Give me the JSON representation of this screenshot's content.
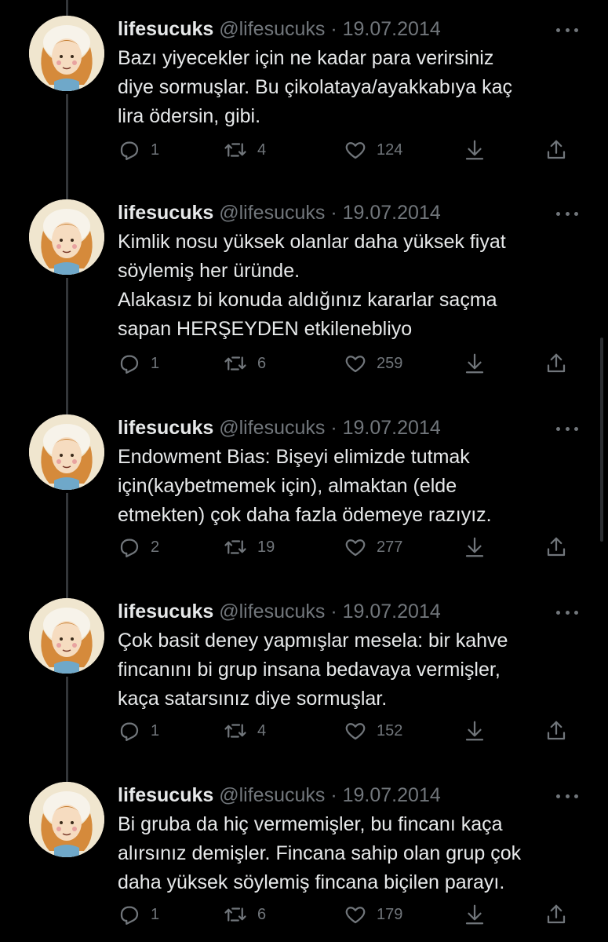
{
  "colors": {
    "background": "#000000",
    "primary_text": "#e7e9ea",
    "secondary_text": "#71767b",
    "thread_line": "#333639"
  },
  "tweets": [
    {
      "display_name": "lifesucuks",
      "handle": "@lifesucuks",
      "separator": "·",
      "date": "19.07.2014",
      "text_lines": [
        "Bazı yiyecekler için ne kadar para verirsiniz",
        "diye sormuşlar. Bu çikolataya/ayakkabıya kaç",
        "lira ödersin, gibi."
      ],
      "replies": "1",
      "retweets": "4",
      "likes": "124",
      "icons": [
        "reply-icon",
        "retweet-icon",
        "like-icon",
        "bookmark-download-icon",
        "share-icon",
        "more-icon"
      ]
    },
    {
      "display_name": "lifesucuks",
      "handle": "@lifesucuks",
      "separator": "·",
      "date": "19.07.2014",
      "text_lines": [
        "Kimlik nosu yüksek olanlar daha yüksek fiyat",
        "söylemiş her üründe.",
        "Alakasız bi konuda aldığınız kararlar saçma",
        "sapan HERŞEYDEN etkilenebliyo"
      ],
      "replies": "1",
      "retweets": "6",
      "likes": "259",
      "icons": [
        "reply-icon",
        "retweet-icon",
        "like-icon",
        "bookmark-download-icon",
        "share-icon",
        "more-icon"
      ]
    },
    {
      "display_name": "lifesucuks",
      "handle": "@lifesucuks",
      "separator": "·",
      "date": "19.07.2014",
      "text_lines": [
        "Endowment Bias: Bişeyi elimizde tutmak",
        "için(kaybetmemek için), almaktan (elde",
        "etmekten) çok daha fazla ödemeye razıyız."
      ],
      "replies": "2",
      "retweets": "19",
      "likes": "277",
      "icons": [
        "reply-icon",
        "retweet-icon",
        "like-icon",
        "bookmark-download-icon",
        "share-icon",
        "more-icon"
      ]
    },
    {
      "display_name": "lifesucuks",
      "handle": "@lifesucuks",
      "separator": "·",
      "date": "19.07.2014",
      "text_lines": [
        "Çok basit deney yapmışlar mesela: bir kahve",
        "fincanını bi grup insana bedavaya vermişler,",
        "kaça satarsınız diye sormuşlar."
      ],
      "replies": "1",
      "retweets": "4",
      "likes": "152",
      "icons": [
        "reply-icon",
        "retweet-icon",
        "like-icon",
        "bookmark-download-icon",
        "share-icon",
        "more-icon"
      ]
    },
    {
      "display_name": "lifesucuks",
      "handle": "@lifesucuks",
      "separator": "·",
      "date": "19.07.2014",
      "text_lines": [
        "Bi gruba da hiç vermemişler, bu fincanı kaça",
        "alırsınız demişler. Fincana sahip olan grup çok",
        "daha yüksek söylemiş fincana biçilen parayı."
      ],
      "replies": "1",
      "retweets": "6",
      "likes": "179",
      "icons": [
        "reply-icon",
        "retweet-icon",
        "like-icon",
        "bookmark-download-icon",
        "share-icon",
        "more-icon"
      ]
    }
  ]
}
